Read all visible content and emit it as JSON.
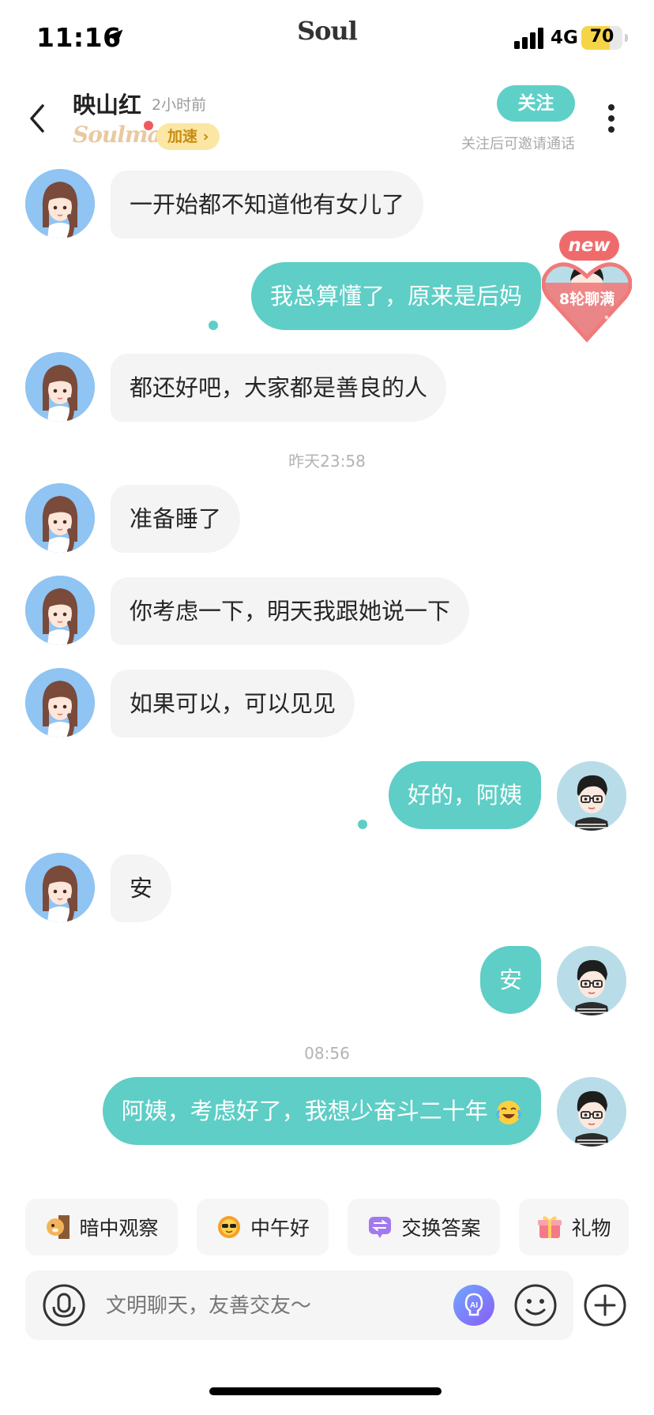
{
  "status_bar": {
    "time": "11:16",
    "brand": "Soul",
    "network": "4G",
    "battery": "70",
    "battery_level_percent": 70
  },
  "header": {
    "name": "映山红",
    "last_seen": "2小时前",
    "soulmate_label": "Soulmate",
    "speed_label": "加速 ›",
    "follow_label": "关注",
    "follow_hint": "关注后可邀请通话"
  },
  "badge": {
    "new_label": "new",
    "rounds_label": "8轮聊满"
  },
  "messages": [
    {
      "from": "her",
      "text": "一开始都不知道他有女儿了"
    },
    {
      "from": "me",
      "text": "我总算懂了，原来是后妈"
    },
    {
      "from": "her",
      "text": "都还好吧，大家都是善良的人"
    },
    {
      "from": "her",
      "text": "准备睡了"
    },
    {
      "from": "her",
      "text": "你考虑一下，明天我跟她说一下"
    },
    {
      "from": "her",
      "text": "如果可以，可以见见"
    },
    {
      "from": "me",
      "text": "好的，阿姨"
    },
    {
      "from": "her",
      "text": "安"
    },
    {
      "from": "me",
      "text": "安"
    },
    {
      "from": "me",
      "text": "阿姨，考虑好了，我想少奋斗二十年"
    }
  ],
  "timestamps": [
    "昨天23:58",
    "08:56"
  ],
  "quick_actions": [
    {
      "label": "暗中观察",
      "icon": "peek-dog-icon"
    },
    {
      "label": "中午好",
      "icon": "sun-sunglasses-icon"
    },
    {
      "label": "交换答案",
      "icon": "exchange-icon"
    },
    {
      "label": "礼物",
      "icon": "gift-icon"
    }
  ],
  "input": {
    "placeholder": "文明聊天，友善交友～"
  },
  "colors": {
    "accent": "#5ecec6",
    "incoming_bubble": "#f4f4f4",
    "badge_red": "#ef6b6b"
  }
}
